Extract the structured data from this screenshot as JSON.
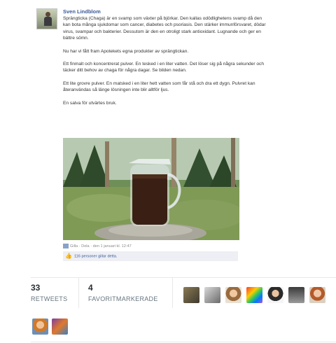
{
  "post": {
    "author": "Sven Lindblom",
    "paragraphs": [
      "Sprängticka (Chaga) är en svamp som växter på björkar. Den kallas odödlighetens svamp då den kan bota många sjukdomar som cancer, diabetes och psoriasis. Den stärker immunförsvaret, dödar virus, svampar och bakterier. Dessutom är den en otroligt stark antioxidant. Lugnande och ger en bättre sömn.",
      "Nu har vi fått fram Apotekets egna produkter av sprängtickan.",
      "Ett finmalt och koncentrerat pulver. En tesked i en liter vatten. Det löser sig på några sekunder och täcker ditt behov av chaga för några dagar. Se bilden nedan.",
      "Ett lite grovre pulver. En matsked i en liter hett vatten som får stå och dra ett dygn. Pulvret kan återanvändas så länge lösningen inte blir alltför ljus.",
      "En salva för utvärtes bruk."
    ],
    "meta": "Gilla · Dela · den 1 januari kl. 12:47",
    "likes": "116 personer gillar detta."
  },
  "stats": {
    "retweets_count": "33",
    "retweets_label": "RETWEETS",
    "favorites_count": "4",
    "favorites_label": "FAVORITMARKERADE"
  },
  "colors": {
    "link_blue": "#3b5998",
    "like_bg": "#edeff4",
    "stat_number": "#292f33",
    "stat_label": "#66757f"
  }
}
